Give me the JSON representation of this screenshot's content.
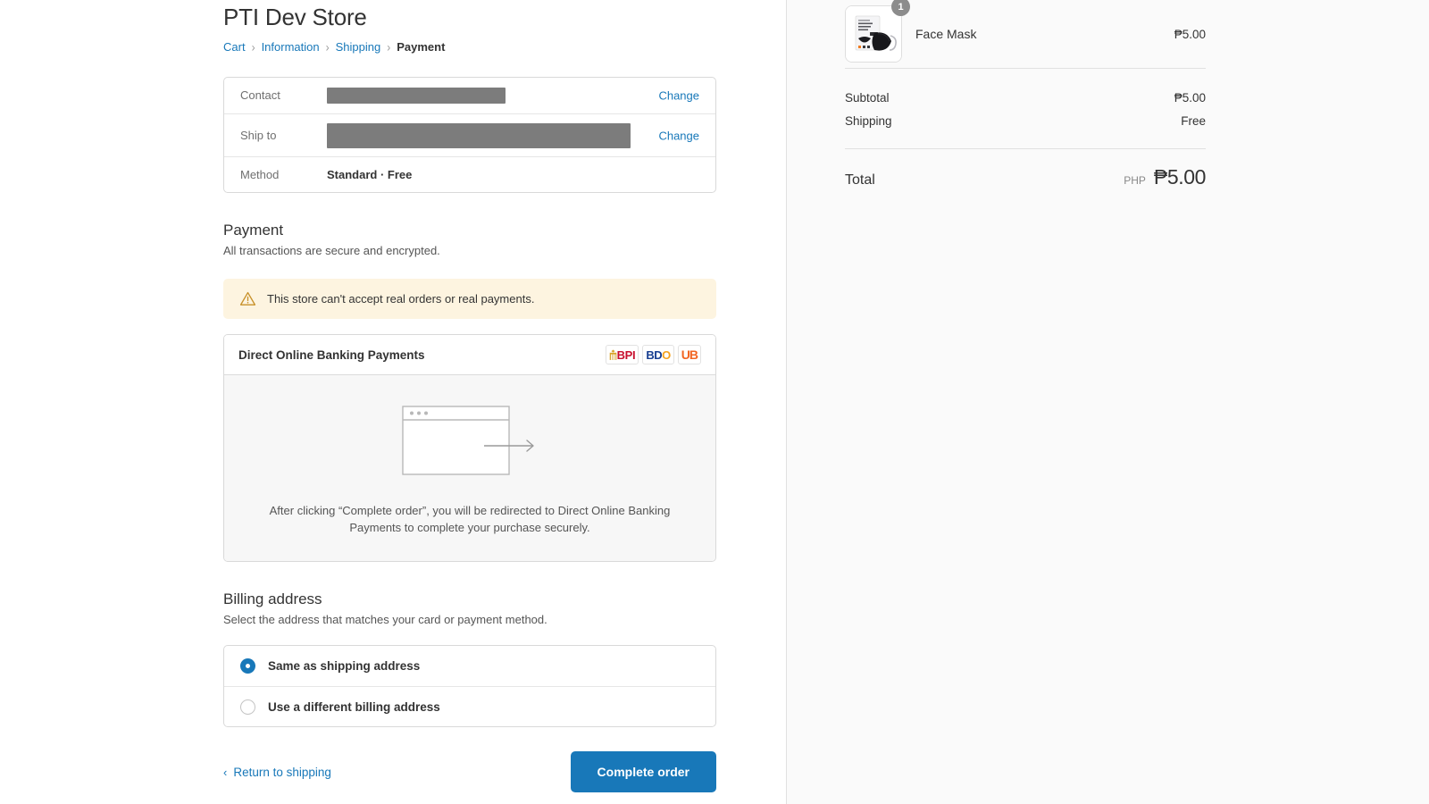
{
  "store": {
    "title": "PTI Dev Store"
  },
  "breadcrumb": {
    "cart": "Cart",
    "information": "Information",
    "shipping": "Shipping",
    "payment": "Payment",
    "separator": "›"
  },
  "review": {
    "contact_label": "Contact",
    "contact_value": "",
    "shipto_label": "Ship to",
    "shipto_value": "",
    "method_label": "Method",
    "method_value": "Standard · Free",
    "change_contact": "Change",
    "change_shipto": "Change"
  },
  "payment": {
    "title": "Payment",
    "subtitle": "All transactions are secure and encrypted.",
    "warning": "This store can't accept real orders or real payments.",
    "method_name": "Direct Online Banking Payments",
    "logos": [
      {
        "name": "bpi-logo",
        "text": "BPI"
      },
      {
        "name": "bdo-logo",
        "text_primary": "BD",
        "text_accent": "O"
      },
      {
        "name": "unionbank-logo",
        "text": "UB"
      }
    ],
    "redirect_text": "After clicking “Complete order”, you will be redirected to Direct Online Banking Payments to complete your purchase securely."
  },
  "billing": {
    "title": "Billing address",
    "subtitle": "Select the address that matches your card or payment method.",
    "option_same": "Same as shipping address",
    "option_different": "Use a different billing address",
    "selected": "same"
  },
  "actions": {
    "back_label": "Return to shipping",
    "back_chevron": "‹",
    "submit_label": "Complete order"
  },
  "summary": {
    "item": {
      "name": "Face Mask",
      "price": "₱5.00",
      "quantity": "1",
      "image_alt": "KF94 Respirator Mask package with black face mask"
    },
    "subtotal_label": "Subtotal",
    "subtotal_value": "₱5.00",
    "shipping_label": "Shipping",
    "shipping_value": "Free",
    "total_label": "Total",
    "total_currency": "PHP",
    "total_value": "₱5.00"
  },
  "colors": {
    "accent": "#1878b9",
    "warning_bg": "#fdf4e0",
    "warning_icon": "#c8912a",
    "sidebar_bg": "#fafafa",
    "bpi_red": "#c8102e",
    "bdo_blue": "#173e91",
    "bdo_orange": "#f6a21d",
    "ub_orange": "#f26522"
  }
}
